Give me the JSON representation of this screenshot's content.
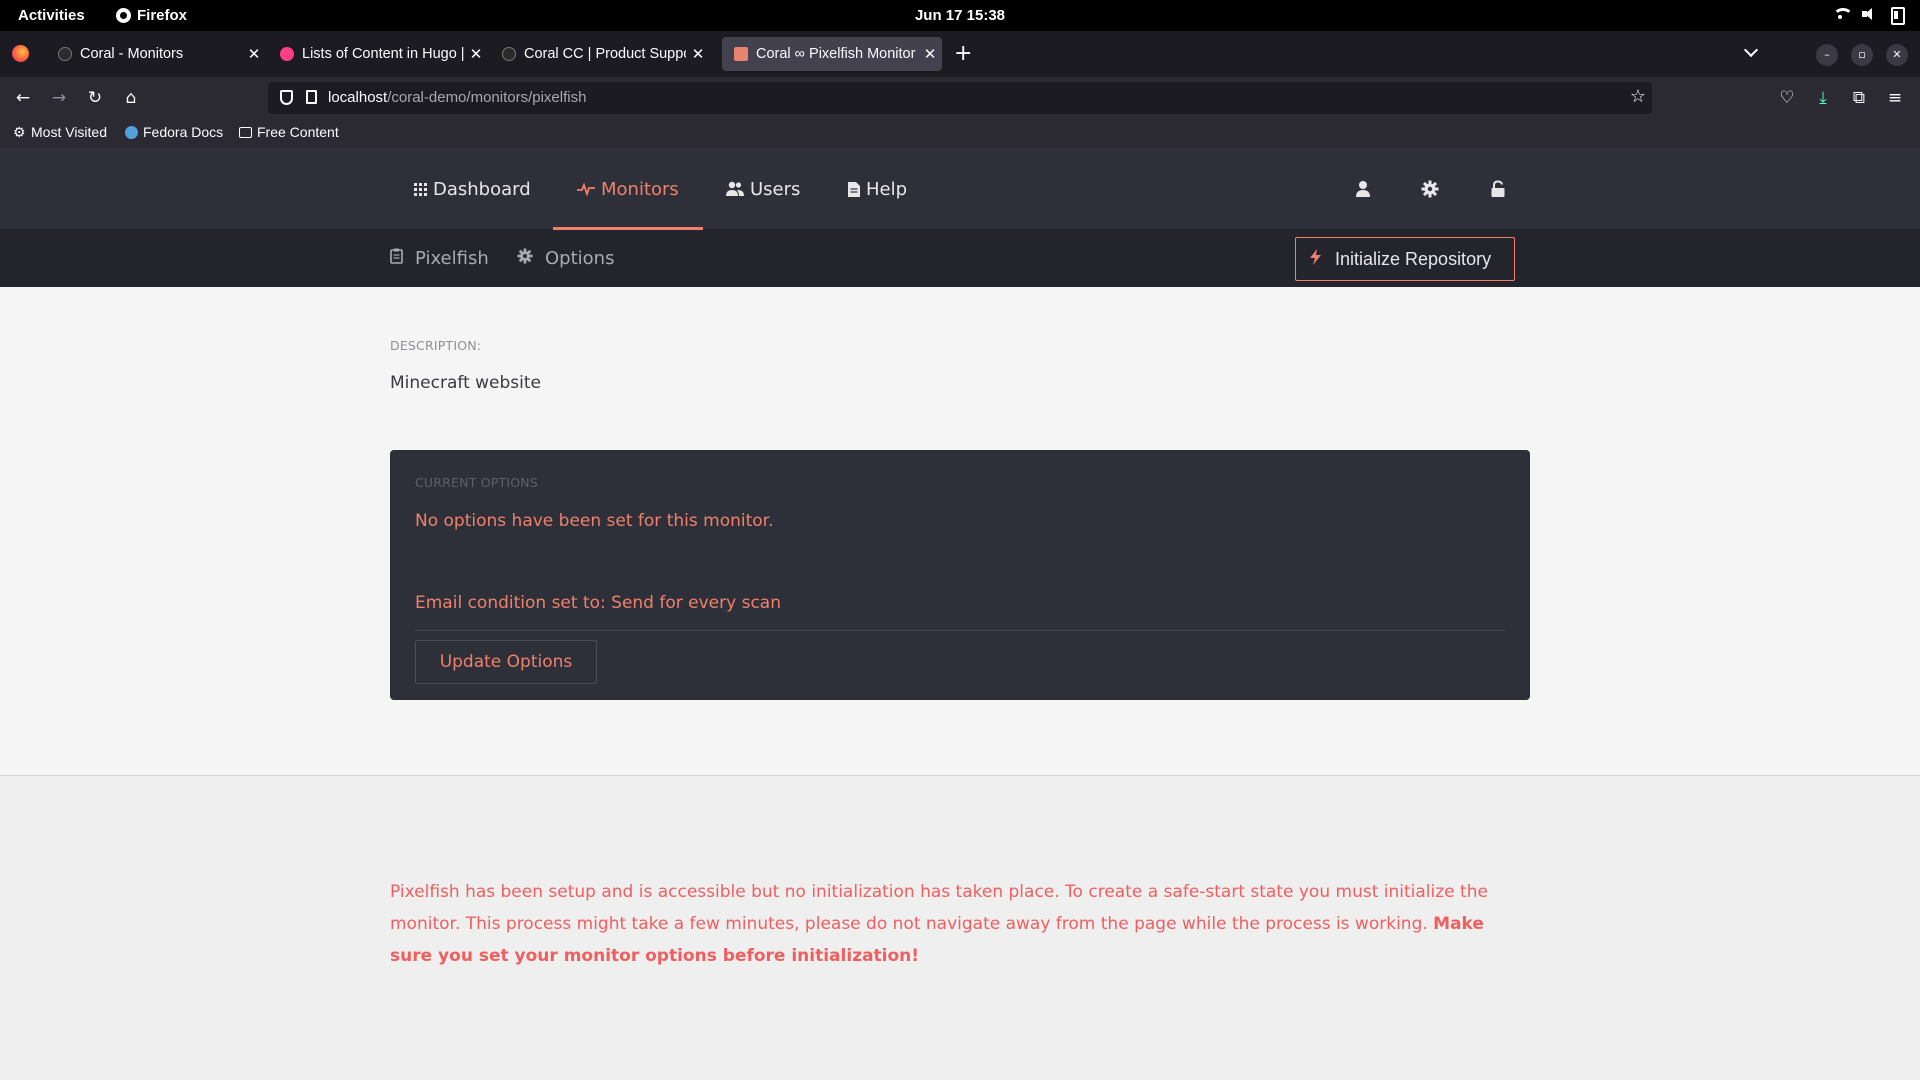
{
  "system": {
    "activities": "Activities",
    "app_name": "Firefox",
    "clock": "Jun 17  15:38"
  },
  "browser": {
    "tabs": [
      {
        "title": "Coral - Monitors",
        "icon": "coral-favicon",
        "active": false
      },
      {
        "title": "Lists of Content in Hugo |",
        "icon": "hugo-favicon",
        "active": false
      },
      {
        "title": "Coral CC | Product Suppo",
        "icon": "coral-favicon",
        "active": false
      },
      {
        "title": "Coral ∞ Pixelfish Monitor",
        "icon": "coral-active-favicon",
        "active": true
      }
    ],
    "close_glyph": "✕",
    "new_tab": "+",
    "url_host": "localhost",
    "url_path": "/coral-demo/monitors/pixelfish",
    "bookmarks": [
      {
        "label": "Most Visited",
        "icon": "gear-icon"
      },
      {
        "label": "Fedora Docs",
        "icon": "fedora-icon"
      },
      {
        "label": "Free Content",
        "icon": "folder-icon"
      }
    ]
  },
  "app": {
    "nav": {
      "dashboard": "Dashboard",
      "monitors": "Monitors",
      "users": "Users",
      "help": "Help"
    },
    "subnav": {
      "monitor_name": "Pixelfish",
      "options": "Options",
      "init_button": "Initialize Repository"
    },
    "description_label": "DESCRIPTION:",
    "description_value": "Minecraft website",
    "options_card": {
      "label": "CURRENT OPTIONS",
      "empty_message": "No options have been set for this monitor.",
      "email_condition": "Email condition set to: Send for every scan",
      "update_button": "Update Options"
    },
    "notice": {
      "text": "Pixelfish has been setup and is accessible but no initialization has taken place. To create a safe-start state you must initialize the monitor. This process might take a few minutes, please do not navigate away from the page while the process is working. ",
      "emphasis": "Make sure you set your monitor options before initialization!"
    }
  },
  "colors": {
    "accent": "#f0806b",
    "notice": "#ef5f5f",
    "header_bg": "#2e3039",
    "subheader_bg": "#24252c"
  }
}
